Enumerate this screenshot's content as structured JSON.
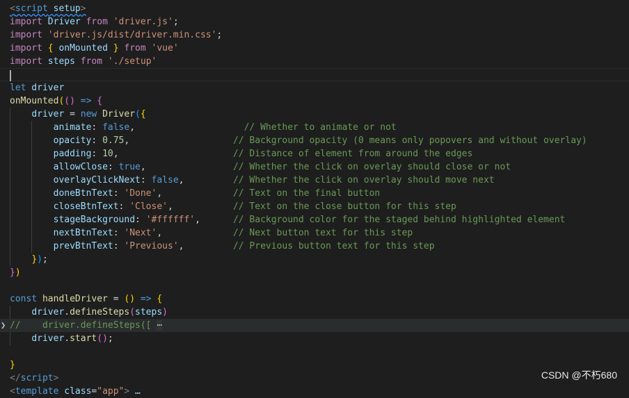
{
  "lines": [
    {
      "segs": [
        [
          "tg",
          "<"
        ],
        [
          "t",
          "script"
        ],
        [
          "v",
          " setup"
        ],
        [
          "tg",
          ">"
        ]
      ],
      "squiggle": true
    },
    {
      "segs": [
        [
          "kc",
          "import"
        ],
        [
          "v",
          " Driver"
        ],
        [
          "kc",
          " from"
        ],
        [
          "s",
          " 'driver.js'"
        ],
        [
          "p",
          ";"
        ]
      ]
    },
    {
      "segs": [
        [
          "kc",
          "import"
        ],
        [
          "s",
          " 'driver.js/dist/driver.min.css'"
        ],
        [
          "p",
          ";"
        ]
      ]
    },
    {
      "segs": [
        [
          "kc",
          "import"
        ],
        [
          "b1",
          " {"
        ],
        [
          "v",
          " onMounted"
        ],
        [
          "b1",
          " }"
        ],
        [
          "kc",
          " from"
        ],
        [
          "s",
          " 'vue'"
        ]
      ]
    },
    {
      "segs": [
        [
          "kc",
          "import"
        ],
        [
          "v",
          " steps"
        ],
        [
          "kc",
          " from"
        ],
        [
          "s",
          " './setup'"
        ]
      ]
    },
    {
      "segs": [],
      "cursor": true
    },
    {
      "segs": [
        [
          "k",
          "let"
        ],
        [
          "v",
          " driver"
        ]
      ]
    },
    {
      "segs": [
        [
          "f",
          "onMounted"
        ],
        [
          "b1",
          "("
        ],
        [
          "b2",
          "()"
        ],
        [
          "p",
          " "
        ],
        [
          "k",
          "=>"
        ],
        [
          "p",
          " "
        ],
        [
          "b2",
          "{"
        ]
      ]
    },
    {
      "segs": [
        [
          "p",
          "    "
        ],
        [
          "v",
          "driver"
        ],
        [
          "p",
          " = "
        ],
        [
          "k",
          "new"
        ],
        [
          "f",
          " Driver"
        ],
        [
          "b3",
          "("
        ],
        [
          "b1",
          "{"
        ]
      ],
      "guides": [
        0
      ]
    },
    {
      "segs": [
        [
          "p",
          "        "
        ],
        [
          "v",
          "animate"
        ],
        [
          "p",
          ": "
        ],
        [
          "k",
          "false"
        ],
        [
          "p",
          ",                    "
        ],
        [
          "c",
          "// Whether to animate or not"
        ]
      ],
      "guides": [
        0,
        1
      ]
    },
    {
      "segs": [
        [
          "p",
          "        "
        ],
        [
          "v",
          "opacity"
        ],
        [
          "p",
          ": "
        ],
        [
          "n",
          "0.75"
        ],
        [
          "p",
          ",                   "
        ],
        [
          "c",
          "// Background opacity (0 means only popovers and without overlay)"
        ]
      ],
      "guides": [
        0,
        1
      ]
    },
    {
      "segs": [
        [
          "p",
          "        "
        ],
        [
          "v",
          "padding"
        ],
        [
          "p",
          ": "
        ],
        [
          "n",
          "10"
        ],
        [
          "p",
          ",                     "
        ],
        [
          "c",
          "// Distance of element from around the edges"
        ]
      ],
      "guides": [
        0,
        1
      ]
    },
    {
      "segs": [
        [
          "p",
          "        "
        ],
        [
          "v",
          "allowClose"
        ],
        [
          "p",
          ": "
        ],
        [
          "k",
          "true"
        ],
        [
          "p",
          ",                "
        ],
        [
          "c",
          "// Whether the click on overlay should close or not"
        ]
      ],
      "guides": [
        0,
        1
      ]
    },
    {
      "segs": [
        [
          "p",
          "        "
        ],
        [
          "v",
          "overlayClickNext"
        ],
        [
          "p",
          ": "
        ],
        [
          "k",
          "false"
        ],
        [
          "p",
          ",         "
        ],
        [
          "c",
          "// Whether the click on overlay should move next"
        ]
      ],
      "guides": [
        0,
        1
      ]
    },
    {
      "segs": [
        [
          "p",
          "        "
        ],
        [
          "v",
          "doneBtnText"
        ],
        [
          "p",
          ": "
        ],
        [
          "s",
          "'Done'"
        ],
        [
          "p",
          ",             "
        ],
        [
          "c",
          "// Text on the final button"
        ]
      ],
      "guides": [
        0,
        1
      ]
    },
    {
      "segs": [
        [
          "p",
          "        "
        ],
        [
          "v",
          "closeBtnText"
        ],
        [
          "p",
          ": "
        ],
        [
          "s",
          "'Close'"
        ],
        [
          "p",
          ",           "
        ],
        [
          "c",
          "// Text on the close button for this step"
        ]
      ],
      "guides": [
        0,
        1
      ]
    },
    {
      "segs": [
        [
          "p",
          "        "
        ],
        [
          "v",
          "stageBackground"
        ],
        [
          "p",
          ": "
        ],
        [
          "s",
          "'#ffffff'"
        ],
        [
          "p",
          ",      "
        ],
        [
          "c",
          "// Background color for the staged behind highlighted element"
        ]
      ],
      "guides": [
        0,
        1
      ]
    },
    {
      "segs": [
        [
          "p",
          "        "
        ],
        [
          "v",
          "nextBtnText"
        ],
        [
          "p",
          ": "
        ],
        [
          "s",
          "'Next'"
        ],
        [
          "p",
          ",             "
        ],
        [
          "c",
          "// Next button text for this step"
        ]
      ],
      "guides": [
        0,
        1
      ]
    },
    {
      "segs": [
        [
          "p",
          "        "
        ],
        [
          "v",
          "prevBtnText"
        ],
        [
          "p",
          ": "
        ],
        [
          "s",
          "'Previous'"
        ],
        [
          "p",
          ",         "
        ],
        [
          "c",
          "// Previous button text for this step"
        ]
      ],
      "guides": [
        0,
        1
      ]
    },
    {
      "segs": [
        [
          "p",
          "    "
        ],
        [
          "b1",
          "}"
        ],
        [
          "b3",
          ")"
        ],
        [
          "p",
          ";"
        ]
      ],
      "guides": [
        0
      ]
    },
    {
      "segs": [
        [
          "b2",
          "}"
        ],
        [
          "b1",
          ")"
        ]
      ]
    },
    {
      "segs": []
    },
    {
      "segs": [
        [
          "k",
          "const"
        ],
        [
          "f",
          " handleDriver"
        ],
        [
          "p",
          " = "
        ],
        [
          "b1",
          "()"
        ],
        [
          "p",
          " "
        ],
        [
          "k",
          "=>"
        ],
        [
          "p",
          " "
        ],
        [
          "b1",
          "{"
        ]
      ]
    },
    {
      "segs": [
        [
          "p",
          "    "
        ],
        [
          "v",
          "driver"
        ],
        [
          "p",
          "."
        ],
        [
          "f",
          "defineSteps"
        ],
        [
          "b2",
          "("
        ],
        [
          "v",
          "steps"
        ],
        [
          "b2",
          ")"
        ]
      ],
      "guides": [
        0
      ]
    },
    {
      "segs": [
        [
          "c",
          "//    driver.defineSteps(["
        ],
        [
          "p",
          " "
        ],
        [
          "ellipsis",
          "⋯"
        ]
      ],
      "fold": true,
      "hl": true
    },
    {
      "segs": [
        [
          "p",
          "    "
        ],
        [
          "v",
          "driver"
        ],
        [
          "p",
          "."
        ],
        [
          "f",
          "start"
        ],
        [
          "b2",
          "()"
        ],
        [
          "p",
          ";"
        ]
      ],
      "guides": [
        0
      ]
    },
    {
      "segs": []
    },
    {
      "segs": [
        [
          "b1",
          "}"
        ]
      ]
    },
    {
      "segs": [
        [
          "tg",
          "</"
        ],
        [
          "t",
          "script"
        ],
        [
          "tg",
          ">"
        ]
      ]
    },
    {
      "segs": [
        [
          "tg",
          "<"
        ],
        [
          "t",
          "template"
        ],
        [
          "v",
          " class"
        ],
        [
          "p",
          "="
        ],
        [
          "s",
          "\"app\""
        ],
        [
          "tg",
          ">"
        ],
        [
          "p",
          " "
        ],
        [
          "v",
          "…"
        ]
      ]
    }
  ],
  "watermark": "CSDN @不朽680"
}
